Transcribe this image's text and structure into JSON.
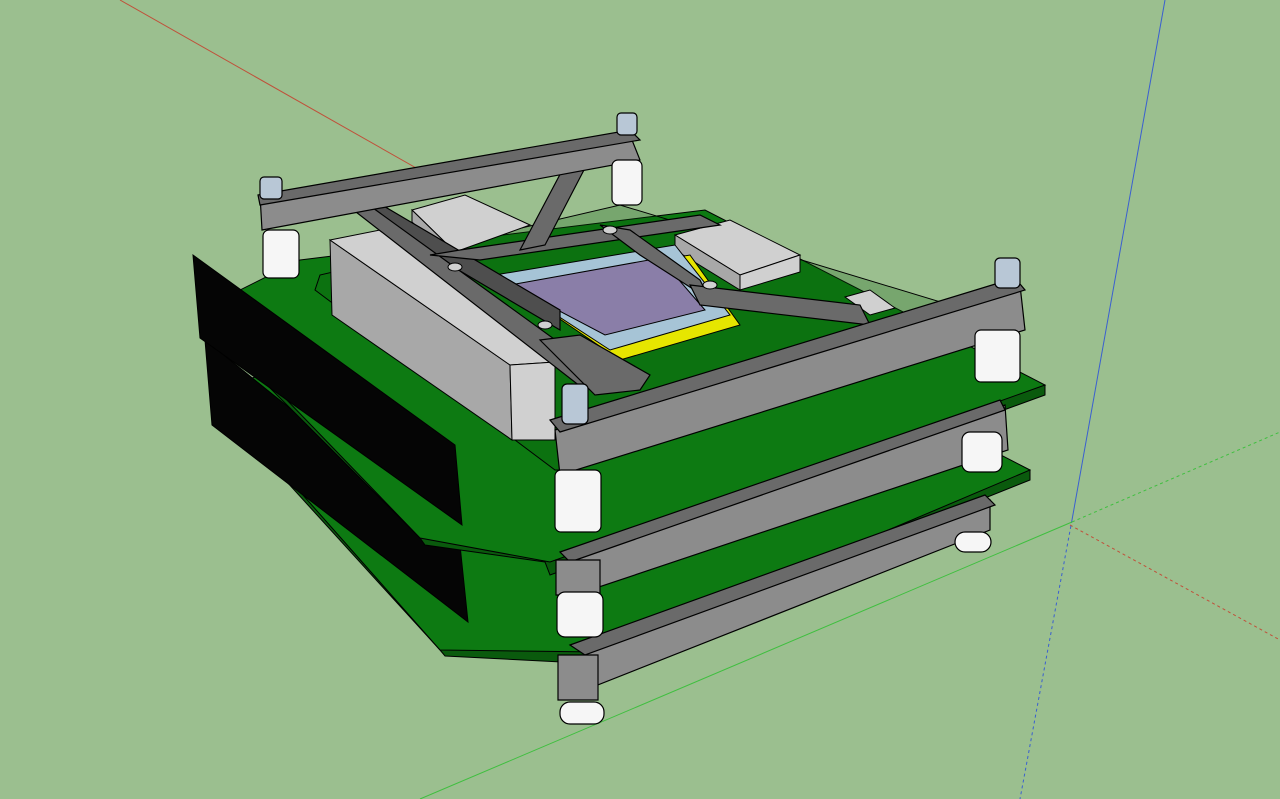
{
  "colors": {
    "background": "#9bbf8f",
    "axis_red": "#c0503a",
    "axis_green": "#3fbf3f",
    "axis_blue": "#3a5fd0",
    "pcb_top": "#0d7a12",
    "pcb_edge": "#0a5a0d",
    "frame_top": "#6a6a6a",
    "frame_side": "#8c8c8c",
    "frame_dark": "#4e4e4e",
    "standoff": "#f6f6f6",
    "pin": "#b8c7d6",
    "heatsink_light": "#d0d0d0",
    "heatsink_dark": "#a8a8a8",
    "connector": "#050505",
    "chip_die": "#8a7ea8",
    "chip_substrate": "#a6c4d6",
    "chip_pad": "#e6e600",
    "outline": "#000000"
  },
  "scene": {
    "view": "3d-perspective",
    "components": [
      "pcb-board",
      "pcb-board",
      "frame-bracket",
      "frame-bracket",
      "frame-bracket",
      "chip",
      "heatsink-block",
      "connector",
      "standoff"
    ]
  }
}
